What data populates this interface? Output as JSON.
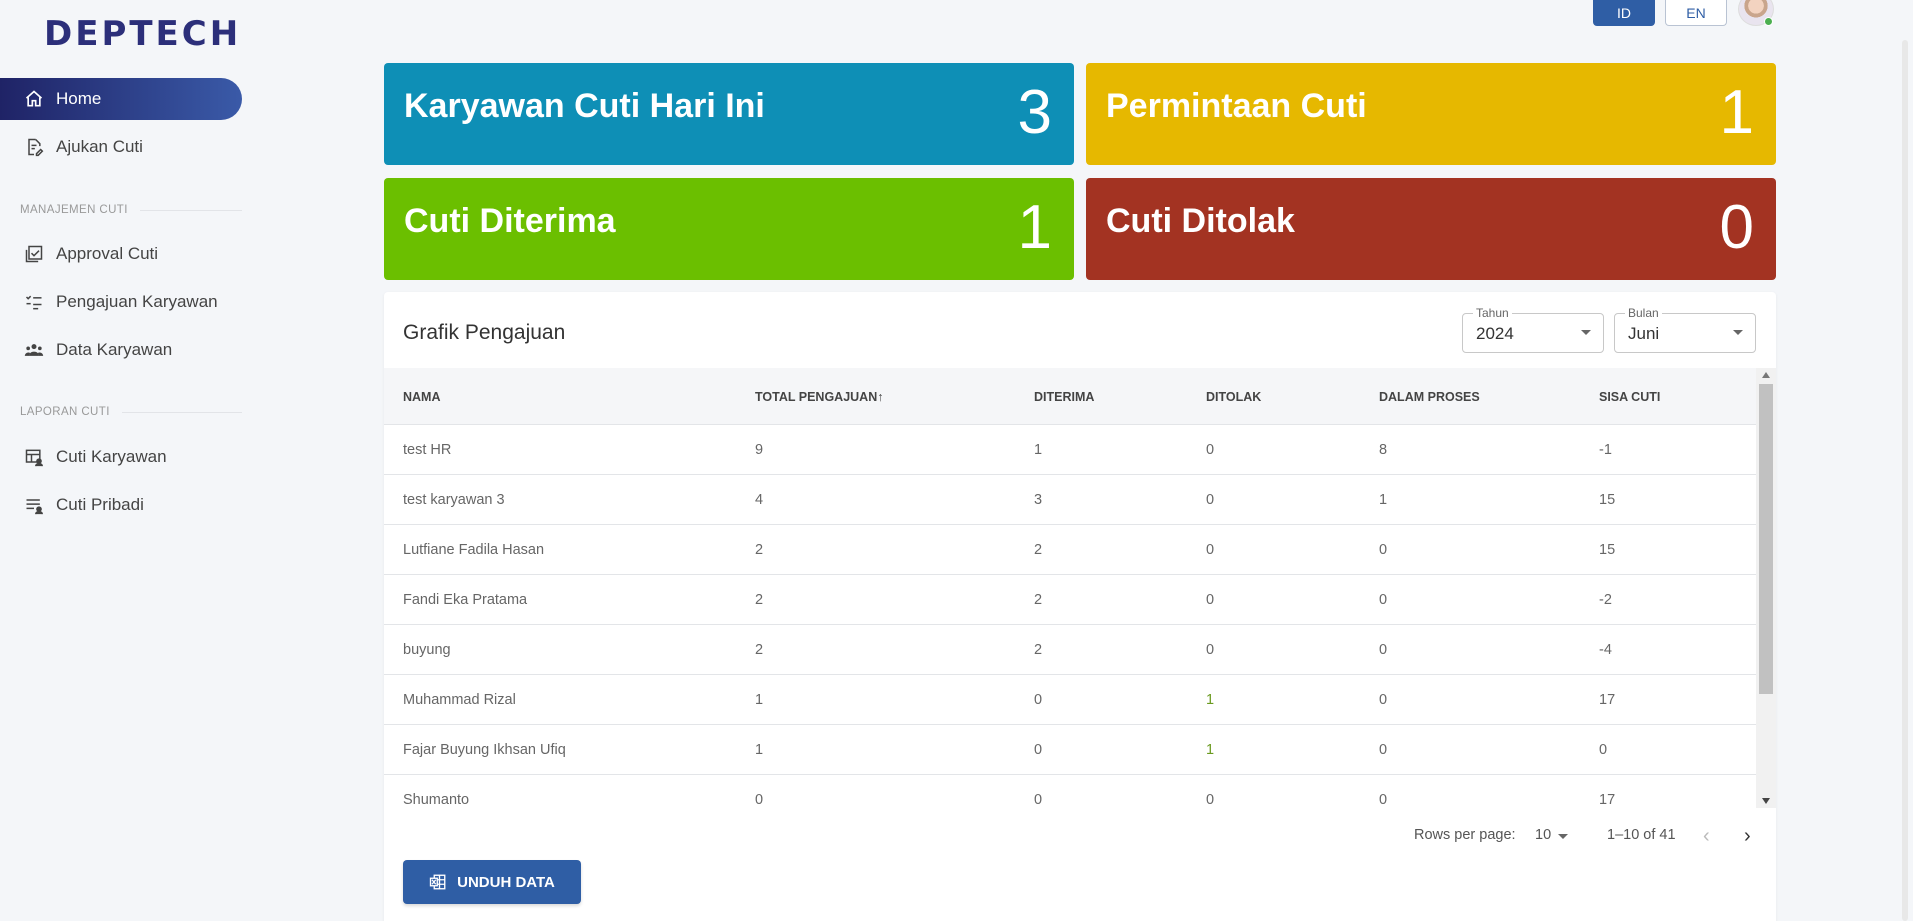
{
  "brand": {
    "logo_text": "DEPTECH"
  },
  "sidebar": {
    "items": [
      {
        "label": "Home",
        "icon": "home-icon",
        "active": true
      },
      {
        "label": "Ajukan Cuti",
        "icon": "document-edit-icon"
      },
      {
        "label": "Approval Cuti",
        "icon": "checkbox-stack-icon"
      },
      {
        "label": "Pengajuan Karyawan",
        "icon": "checklist-icon"
      },
      {
        "label": "Data Karyawan",
        "icon": "people-icon"
      },
      {
        "label": "Cuti Karyawan",
        "icon": "table-user-icon"
      },
      {
        "label": "Cuti Pribadi",
        "icon": "list-user-icon"
      }
    ],
    "sections": [
      {
        "label": "MANAJEMEN CUTI"
      },
      {
        "label": "LAPORAN CUTI"
      }
    ]
  },
  "topbar": {
    "lang_id": "ID",
    "lang_en": "EN",
    "active_lang": "ID"
  },
  "stats": [
    {
      "title": "Karyawan Cuti Hari Ini",
      "value": "3",
      "color": "#0e8fb6"
    },
    {
      "title": "Permintaan Cuti",
      "value": "1",
      "color": "#e6b800"
    },
    {
      "title": "Cuti Diterima",
      "value": "1",
      "color": "#6bbf00"
    },
    {
      "title": "Cuti Ditolak",
      "value": "0",
      "color": "#a33322"
    }
  ],
  "panel": {
    "title": "Grafik Pengajuan",
    "year": {
      "label": "Tahun",
      "value": "2024"
    },
    "month": {
      "label": "Bulan",
      "value": "Juni"
    }
  },
  "table": {
    "headers": [
      "NAMA",
      "TOTAL PENGAJUAN",
      "DITERIMA",
      "DITOLAK",
      "DALAM PROSES",
      "SISA CUTI"
    ],
    "sort_indicator": "↑",
    "rows": [
      [
        "test HR",
        "9",
        "1",
        "0",
        "8",
        "-1"
      ],
      [
        "test karyawan 3",
        "4",
        "3",
        "0",
        "1",
        "15"
      ],
      [
        "Lutfiane Fadila Hasan",
        "2",
        "2",
        "0",
        "0",
        "15"
      ],
      [
        "Fandi Eka Pratama",
        "2",
        "2",
        "0",
        "0",
        "-2"
      ],
      [
        "buyung",
        "2",
        "2",
        "0",
        "0",
        "-4"
      ],
      [
        "Muhammad Rizal",
        "1",
        "0",
        "1",
        "0",
        "17"
      ],
      [
        "Fajar Buyung Ikhsan Ufiq",
        "1",
        "0",
        "1",
        "0",
        "0"
      ],
      [
        "Shumanto",
        "0",
        "0",
        "0",
        "0",
        "17"
      ]
    ]
  },
  "pagination": {
    "rows_per_page_label": "Rows per page:",
    "rows_per_page": "10",
    "range": "1–10 of 41"
  },
  "actions": {
    "download_label": "UNDUH DATA"
  }
}
